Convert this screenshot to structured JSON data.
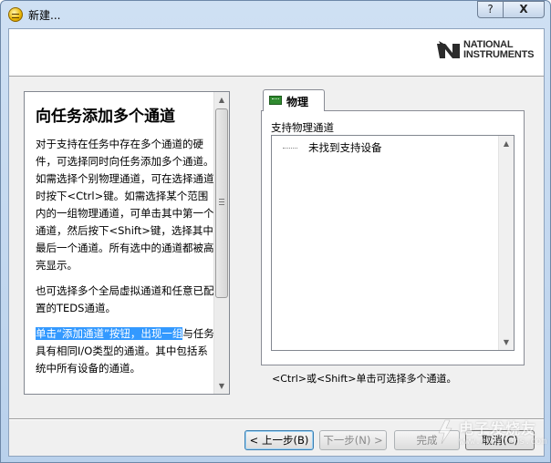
{
  "window": {
    "title": "新建...",
    "help_button": "?",
    "close_button": "X"
  },
  "banner": {
    "logo_line1": "NATIONAL",
    "logo_line2": "INSTRUMENTS"
  },
  "help_panel": {
    "heading": "向任务添加多个通道",
    "para1": "对于支持在任务中存在多个通道的硬件，可选择同时向任务添加多个通道。如需选择个别物理通道，可在选择通道时按下<Ctrl>键。如需选择某个范围内的一组物理通道，可单击其中第一个通道，然后按下<Shift>键，选择其中最后一个通道。所有选中的通道都被高亮显示。",
    "para2": "也可选择多个全局虚拟通道和任意已配置的TEDS通道。",
    "para3_highlight": "单击“添加通道”按钮，出现一组",
    "para3_rest": "与任务具有相同I/O类型的通道。其中包括系统中所有设备的通道。"
  },
  "tab": {
    "label": "物理"
  },
  "channels": {
    "group_label": "支持物理通道",
    "empty_item": "未找到支持设备",
    "hint": "<Ctrl>或<Shift>单击可选择多个通道。"
  },
  "buttons": {
    "back": "< 上一步(B)",
    "next": "下一步(N) >",
    "finish": "完成",
    "cancel": "取消(C)"
  },
  "watermark": {
    "text": "电子发烧友",
    "sub": "www.elecfans.com"
  },
  "colors": {
    "selection": "#3399ff",
    "title_bar": "#cfe0f3",
    "tab_icon": "#2f8a2f"
  }
}
